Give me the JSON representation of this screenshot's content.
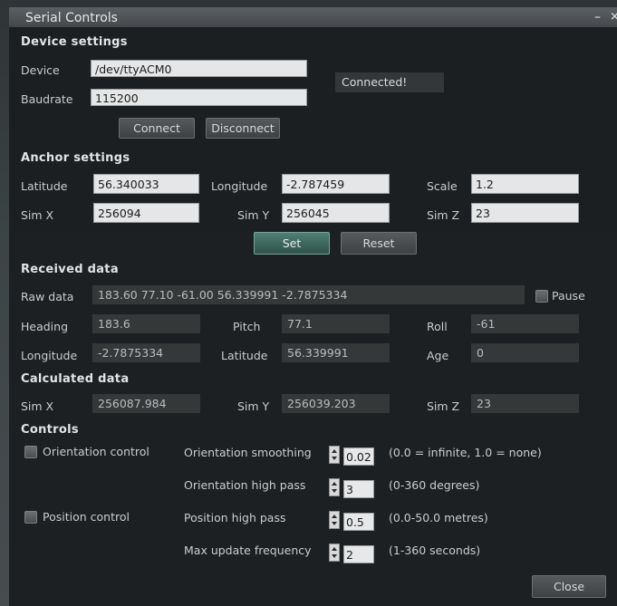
{
  "window": {
    "title": "Serial Controls",
    "minimize": "–",
    "close_glyph": "×"
  },
  "device_settings": {
    "heading": "Device settings",
    "device_label": "Device",
    "device_value": "/dev/ttyACM0",
    "baudrate_label": "Baudrate",
    "baudrate_value": "115200",
    "status": "Connected!",
    "connect": "Connect",
    "disconnect": "Disconnect"
  },
  "anchor_settings": {
    "heading": "Anchor settings",
    "latitude_label": "Latitude",
    "latitude": "56.340033",
    "longitude_label": "Longitude",
    "longitude": "-2.787459",
    "scale_label": "Scale",
    "scale": "1.2",
    "simx_label": "Sim X",
    "simx": "256094",
    "simy_label": "Sim Y",
    "simy": "256045",
    "simz_label": "Sim Z",
    "simz": "23",
    "set": "Set",
    "reset": "Reset"
  },
  "received_data": {
    "heading": "Received data",
    "raw_label": "Raw data",
    "raw": "183.60 77.10 -61.00 56.339991 -2.7875334",
    "pause_label": "Pause",
    "heading_label": "Heading",
    "heading_value": "183.6",
    "pitch_label": "Pitch",
    "pitch": "77.1",
    "roll_label": "Roll",
    "roll": "-61",
    "longitude_label": "Longitude",
    "longitude": "-2.7875334",
    "latitude_label": "Latitude",
    "latitude": "56.339991",
    "age_label": "Age",
    "age": "0"
  },
  "calculated_data": {
    "heading": "Calculated data",
    "simx_label": "Sim X",
    "simx": "256087.984",
    "simy_label": "Sim Y",
    "simy": "256039.203",
    "simz_label": "Sim Z",
    "simz": "23"
  },
  "controls": {
    "heading": "Controls",
    "orientation_control": "Orientation control",
    "position_control": "Position control",
    "orientation_smoothing_label": "Orientation smoothing",
    "orientation_smoothing": "0.02",
    "orientation_smoothing_hint": "(0.0 = infinite, 1.0 = none)",
    "orientation_highpass_label": "Orientation high pass",
    "orientation_highpass": "3",
    "orientation_highpass_hint": "(0-360 degrees)",
    "position_highpass_label": "Position high pass",
    "position_highpass": "0.5",
    "position_highpass_hint": "(0.0-50.0 metres)",
    "max_update_label": "Max update frequency",
    "max_update": "2",
    "max_update_hint": "(1-360 seconds)"
  },
  "footer": {
    "close": "Close"
  }
}
